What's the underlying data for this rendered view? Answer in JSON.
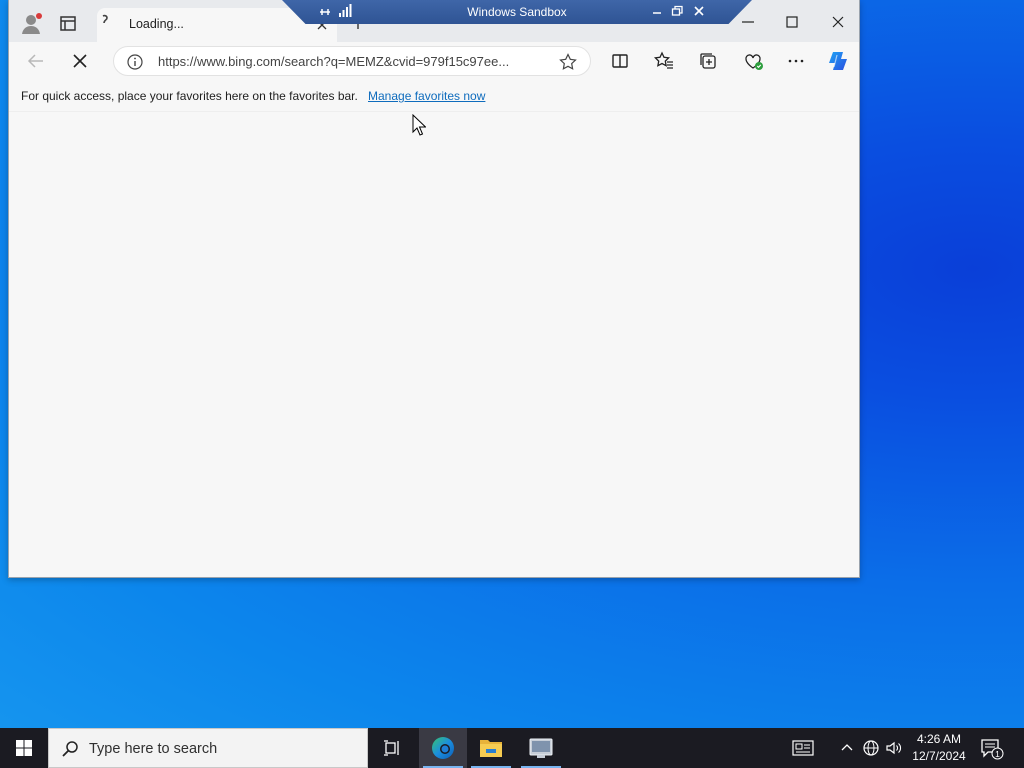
{
  "browser": {
    "tab": {
      "title": "Loading..."
    },
    "sandbox_bar": {
      "title": "Windows Sandbox"
    },
    "address": {
      "url": "https://www.bing.com/search?q=MEMZ&cvid=979f15c97ee..."
    },
    "favorites_bar": {
      "message": "For quick access, place your favorites here on the favorites bar.",
      "link": "Manage favorites now"
    }
  },
  "taskbar": {
    "search_placeholder": "Type here to search",
    "time": "4:26 AM",
    "date": "12/7/2024",
    "notification_count": "1"
  },
  "icons": [
    "profile-icon",
    "tab-actions-icon",
    "close-icon",
    "plus-icon",
    "pin-icon",
    "signal-icon",
    "minimize-icon",
    "maximize-icon",
    "back-arrow-icon",
    "stop-icon",
    "info-icon",
    "star-icon",
    "split-screen-icon",
    "favorites-icon",
    "collections-icon",
    "browser-essentials-icon",
    "more-icon",
    "copilot-icon",
    "windows-logo-icon",
    "search-icon",
    "task-view-icon",
    "edge-icon",
    "folder-icon",
    "sandbox-icon",
    "news-icon",
    "chevron-up-icon",
    "network-icon",
    "volume-icon",
    "notification-icon"
  ]
}
